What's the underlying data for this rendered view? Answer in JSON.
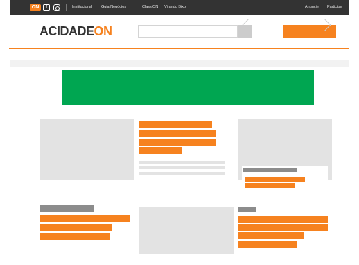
{
  "topbar": {
    "logo_badge": "ON",
    "social": {
      "facebook_icon": "facebook-icon",
      "instagram_icon": "instagram-icon"
    },
    "nav_left": [
      "Institucional",
      "Guia Negócios",
      "ClassiON",
      "Virando Bixo"
    ],
    "nav_right": [
      "Anuncie",
      "Participe"
    ]
  },
  "header": {
    "logo_text": "ACIDADE",
    "logo_accent": "ON",
    "search_placeholder": ""
  },
  "colors": {
    "brand_orange": "#f6821f",
    "ad_green": "#00a651",
    "topbar_dark": "#333333",
    "placeholder_grey": "#e3e3e3"
  }
}
